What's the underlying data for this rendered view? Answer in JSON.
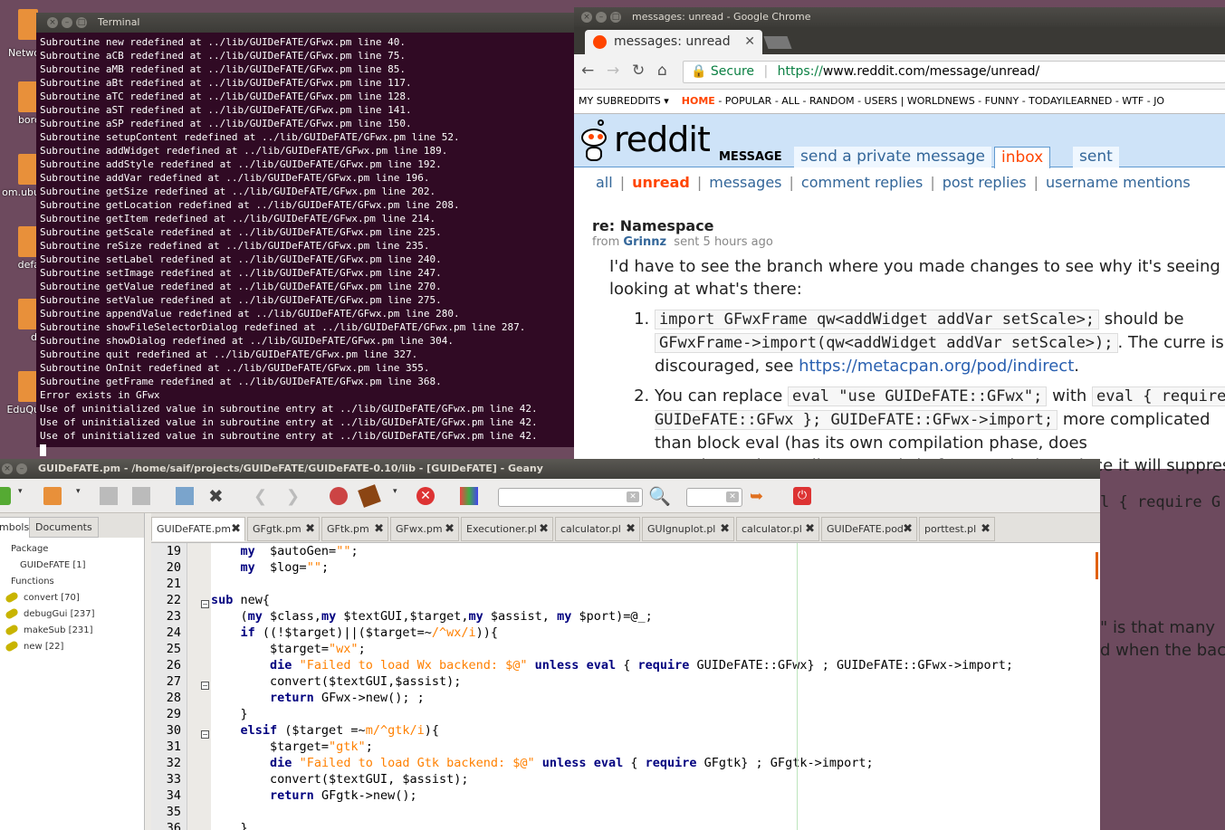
{
  "desktop": {
    "icons": [
      {
        "label": "Netwo",
        "icon": "folder-icon"
      },
      {
        "label": "borc",
        "icon": "folder-icon"
      },
      {
        "label": "om.ubu",
        "icon": "folder-icon"
      },
      {
        "label": "defa",
        "icon": "folder-icon"
      },
      {
        "label": "di",
        "icon": "folder-icon"
      },
      {
        "label": "EduQu",
        "icon": "folder-icon"
      }
    ]
  },
  "terminal": {
    "title": "Terminal",
    "lines": [
      "Subroutine new redefined at ../lib/GUIDeFATE/GFwx.pm line 40.",
      "Subroutine aCB redefined at ../lib/GUIDeFATE/GFwx.pm line 75.",
      "Subroutine aMB redefined at ../lib/GUIDeFATE/GFwx.pm line 85.",
      "Subroutine aBt redefined at ../lib/GUIDeFATE/GFwx.pm line 117.",
      "Subroutine aTC redefined at ../lib/GUIDeFATE/GFwx.pm line 128.",
      "Subroutine aST redefined at ../lib/GUIDeFATE/GFwx.pm line 141.",
      "Subroutine aSP redefined at ../lib/GUIDeFATE/GFwx.pm line 150.",
      "Subroutine setupContent redefined at ../lib/GUIDeFATE/GFwx.pm line 52.",
      "Subroutine addWidget redefined at ../lib/GUIDeFATE/GFwx.pm line 189.",
      "Subroutine addStyle redefined at ../lib/GUIDeFATE/GFwx.pm line 192.",
      "Subroutine addVar redefined at ../lib/GUIDeFATE/GFwx.pm line 196.",
      "Subroutine getSize redefined at ../lib/GUIDeFATE/GFwx.pm line 202.",
      "Subroutine getLocation redefined at ../lib/GUIDeFATE/GFwx.pm line 208.",
      "Subroutine getItem redefined at ../lib/GUIDeFATE/GFwx.pm line 214.",
      "Subroutine getScale redefined at ../lib/GUIDeFATE/GFwx.pm line 225.",
      "Subroutine reSize redefined at ../lib/GUIDeFATE/GFwx.pm line 235.",
      "Subroutine setLabel redefined at ../lib/GUIDeFATE/GFwx.pm line 240.",
      "Subroutine setImage redefined at ../lib/GUIDeFATE/GFwx.pm line 247.",
      "Subroutine getValue redefined at ../lib/GUIDeFATE/GFwx.pm line 270.",
      "Subroutine setValue redefined at ../lib/GUIDeFATE/GFwx.pm line 275.",
      "Subroutine appendValue redefined at ../lib/GUIDeFATE/GFwx.pm line 280.",
      "Subroutine showFileSelectorDialog redefined at ../lib/GUIDeFATE/GFwx.pm line 287.",
      "Subroutine showDialog redefined at ../lib/GUIDeFATE/GFwx.pm line 304.",
      "Subroutine quit redefined at ../lib/GUIDeFATE/GFwx.pm line 327.",
      "Subroutine OnInit redefined at ../lib/GUIDeFATE/GFwx.pm line 355.",
      "Subroutine getFrame redefined at ../lib/GUIDeFATE/GFwx.pm line 368.",
      "Error exists in GFwx",
      "Use of uninitialized value in subroutine entry at ../lib/GUIDeFATE/GFwx.pm line 42.",
      "Use of uninitialized value in subroutine entry at ../lib/GUIDeFATE/GFwx.pm line 42.",
      "Use of uninitialized value in subroutine entry at ../lib/GUIDeFATE/GFwx.pm line 42."
    ]
  },
  "chrome": {
    "window_title": "messages: unread - Google Chrome",
    "tab_title": "messages: unread",
    "secure_label": "Secure",
    "url_scheme": "https://",
    "url_rest": "www.reddit.com/message/unread/",
    "subreddit_bar": {
      "my_subreddits": "MY SUBREDDITS",
      "home": "HOME",
      "links": "- POPULAR - ALL - RANDOM - USERS  |  WORLDNEWS - FUNNY - TODAYILEARNED - WTF - JO"
    },
    "wordmark": "reddit",
    "page_name": "MESSAGE",
    "tabs": {
      "send": "send a private message",
      "inbox": "inbox",
      "sent": "sent"
    },
    "filters": {
      "all": "all",
      "unread": "unread",
      "messages": "messages",
      "comment_replies": "comment replies",
      "post_replies": "post replies",
      "username_mentions": "username mentions"
    },
    "message": {
      "subject": "re: Namespace",
      "from_label": "from",
      "author": "Grinnz",
      "sent": "sent 5 hours ago",
      "intro": "I'd have to see the branch where you made changes to see why it's seeing re looking at what's there:",
      "item1_code1": "import GFwxFrame qw<addWidget addVar setScale>;",
      "item1_text1": " should be",
      "item1_code2": "GFwxFrame->import(qw<addWidget addVar setScale>);",
      "item1_text2": ". The curre is discouraged, see ",
      "item1_link": "https://metacpan.org/pod/indirect",
      "item1_text3": ".",
      "item2_text1": "You can replace ",
      "item2_code1": "eval \"use GUIDeFATE::GFwx\";",
      "item2_text2": " with",
      "item2_code2": "eval { require GUIDeFATE::GFwx }; GUIDeFATE::GFwx->import;",
      "item2_text3": " more complicated than block eval (has its own compilation phase, does",
      "item2_text4": "sure the eval actually succeeds before continuing, since it will suppress"
    },
    "behind_text": {
      "b1": "l { require G",
      "b2": "\"  is that many",
      "b3": "d when the back"
    }
  },
  "geany": {
    "title": "GUIDeFATE.pm - /home/saif/projects/GUIDeFATE/GUIDeFATE-0.10/lib - [GUIDeFATE] - Geany",
    "sidebar_tabs": [
      "mbols",
      "Documents"
    ],
    "tree": [
      {
        "label": "Package"
      },
      {
        "label": "GUIDeFATE [1]"
      },
      {
        "label": "Functions"
      },
      {
        "label": "convert [70]"
      },
      {
        "label": "debugGui [237]"
      },
      {
        "label": "makeSub [231]"
      },
      {
        "label": "new [22]"
      }
    ],
    "file_tabs": [
      "GUIDeFATE.pm",
      "GFgtk.pm",
      "GFtk.pm",
      "GFwx.pm",
      "Executioner.pl",
      "calculator.pl",
      "GUIgnuplot.pl",
      "calculator.pl",
      "GUIDeFATE.pod",
      "porttest.pl"
    ],
    "line_numbers": [
      "19",
      "20",
      "21",
      "22",
      "23",
      "24",
      "25",
      "26",
      "27",
      "28",
      "29",
      "30",
      "31",
      "32",
      "33",
      "34",
      "35",
      "36"
    ]
  }
}
